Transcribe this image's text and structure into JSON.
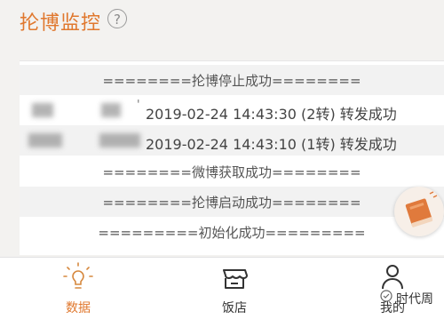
{
  "header": {
    "title": "抡博监控",
    "help_icon": "?"
  },
  "log": {
    "lines": [
      "========抡博停止成功========",
      "2019-02-24 14:43:30 (2转) 转发成功",
      "2019-02-24 14:43:10 (1转) 转发成功",
      "========微博获取成功========",
      "========抡博启动成功========",
      "=========初始化成功========="
    ]
  },
  "floating_button": {
    "icon": "book-icon"
  },
  "tabbar": {
    "tabs": [
      {
        "label": "数据",
        "icon": "lightbulb-icon"
      },
      {
        "label": "饭店",
        "icon": "shop-icon"
      },
      {
        "label": "我的",
        "icon": "person-icon"
      }
    ]
  },
  "watermark": {
    "text": "时代周"
  },
  "colors": {
    "accent": "#e0782e",
    "background": "#f3f2f0",
    "panel": "#ffffff",
    "row_alt": "#f2f2f2"
  }
}
